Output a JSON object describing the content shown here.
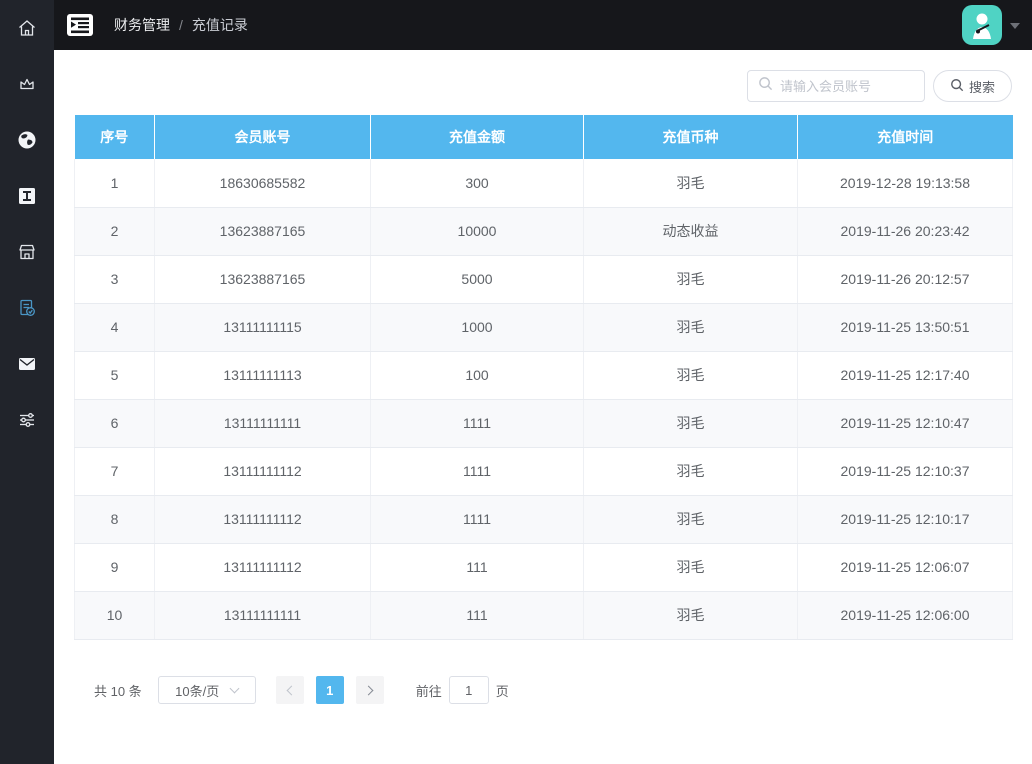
{
  "topbar": {
    "breadcrumb": [
      "财务管理",
      "充值记录"
    ],
    "breadcrumb_separator": "/"
  },
  "sidebar": {
    "icons": [
      "home-icon",
      "crown-icon",
      "globe-icon",
      "letter-i-icon",
      "shop-icon",
      "document-check-icon",
      "mail-icon",
      "sliders-icon"
    ],
    "active_icon": "document-check-icon"
  },
  "search": {
    "placeholder": "请输入会员账号",
    "button_label": "搜索"
  },
  "table": {
    "columns": [
      "序号",
      "会员账号",
      "充值金额",
      "充值币种",
      "充值时间"
    ],
    "rows": [
      [
        "1",
        "18630685582",
        "300",
        "羽毛",
        "2019-12-28 19:13:58"
      ],
      [
        "2",
        "13623887165",
        "10000",
        "动态收益",
        "2019-11-26 20:23:42"
      ],
      [
        "3",
        "13623887165",
        "5000",
        "羽毛",
        "2019-11-26 20:12:57"
      ],
      [
        "4",
        "13111111115",
        "1000",
        "羽毛",
        "2019-11-25 13:50:51"
      ],
      [
        "5",
        "13111111113",
        "100",
        "羽毛",
        "2019-11-25 12:17:40"
      ],
      [
        "6",
        "13111111111",
        "1111",
        "羽毛",
        "2019-11-25 12:10:47"
      ],
      [
        "7",
        "13111111112",
        "1111",
        "羽毛",
        "2019-11-25 12:10:37"
      ],
      [
        "8",
        "13111111112",
        "1111",
        "羽毛",
        "2019-11-25 12:10:17"
      ],
      [
        "9",
        "13111111112",
        "111",
        "羽毛",
        "2019-11-25 12:06:07"
      ],
      [
        "10",
        "13111111111",
        "111",
        "羽毛",
        "2019-11-25 12:06:00"
      ]
    ]
  },
  "pagination": {
    "total_label": "共 10 条",
    "page_size_label": "10条/页",
    "current_page": "1",
    "goto_label": "前往",
    "goto_value": "1",
    "goto_suffix": "页"
  },
  "colors": {
    "table_header_blue": "#53b7ee",
    "active_page_blue": "#53b7ee",
    "avatar_teal": "#4fd3c4",
    "active_icon_blue": "#4a96c6",
    "sidebar_bg": "#21242b",
    "topbar_bg": "#16171b"
  }
}
